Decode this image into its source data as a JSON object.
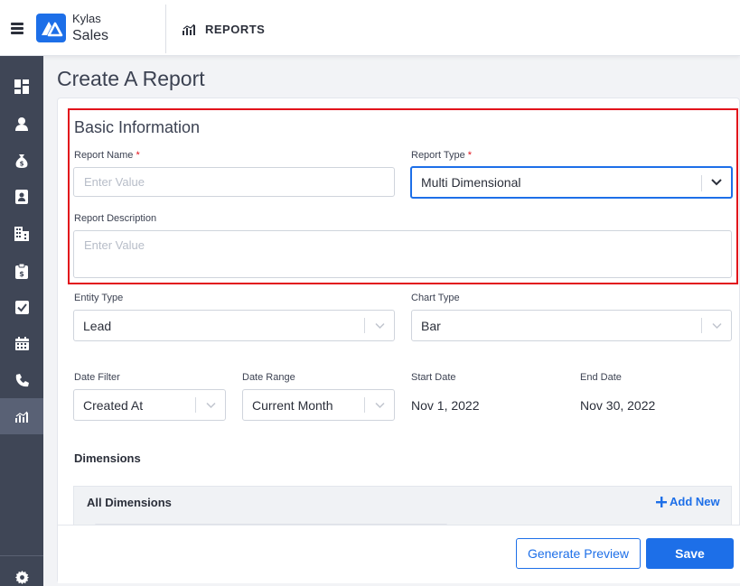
{
  "header": {
    "brand_line1": "Kylas",
    "brand_line2": "Sales",
    "section_label": "REPORTS",
    "accent_color": "#1d6fe8"
  },
  "sidebar": {
    "items": [
      {
        "icon": "dashboard-icon"
      },
      {
        "icon": "user-icon"
      },
      {
        "icon": "money-bag-icon"
      },
      {
        "icon": "contact-card-icon"
      },
      {
        "icon": "building-icon"
      },
      {
        "icon": "clipboard-icon"
      },
      {
        "icon": "checkbox-icon"
      },
      {
        "icon": "calendar-icon"
      },
      {
        "icon": "phone-icon"
      },
      {
        "icon": "reports-icon",
        "active": true
      }
    ],
    "settings_icon": "gear-icon"
  },
  "page": {
    "title": "Create A Report"
  },
  "basic_info": {
    "title": "Basic Information",
    "report_name_label": "Report Name",
    "report_name_placeholder": "Enter Value",
    "report_type_label": "Report Type",
    "report_type_value": "Multi Dimensional",
    "description_label": "Report Description",
    "description_placeholder": "Enter Value",
    "required_mark": "*"
  },
  "config": {
    "entity_type_label": "Entity Type",
    "entity_type_value": "Lead",
    "chart_type_label": "Chart Type",
    "chart_type_value": "Bar",
    "date_filter_label": "Date Filter",
    "date_filter_value": "Created At",
    "date_range_label": "Date Range",
    "date_range_value": "Current Month",
    "start_date_label": "Start Date",
    "start_date_value": "Nov 1, 2022",
    "end_date_label": "End Date",
    "end_date_value": "Nov 30, 2022"
  },
  "dimensions": {
    "title": "Dimensions",
    "all_label": "All Dimensions",
    "add_new_label": "Add New"
  },
  "footer": {
    "preview_label": "Generate Preview",
    "save_label": "Save"
  }
}
